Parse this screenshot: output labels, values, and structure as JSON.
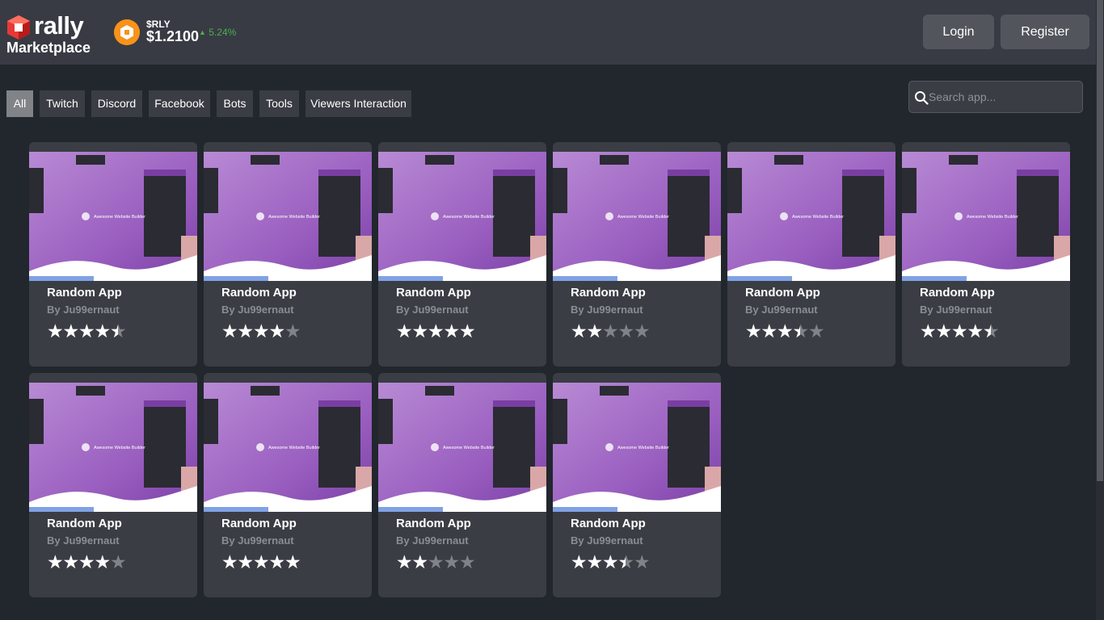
{
  "header": {
    "logo_word": "rally",
    "logo_sub": "Marketplace",
    "token": {
      "symbol": "$RLY",
      "price": "$1.2100",
      "change": "5.24%",
      "change_color": "#4caf50"
    },
    "login_label": "Login",
    "register_label": "Register"
  },
  "filters": {
    "items": [
      {
        "label": "All",
        "active": true
      },
      {
        "label": "Twitch",
        "active": false
      },
      {
        "label": "Discord",
        "active": false
      },
      {
        "label": "Facebook",
        "active": false
      },
      {
        "label": "Bots",
        "active": false
      },
      {
        "label": "Tools",
        "active": false
      },
      {
        "label": "Viewers Interaction",
        "active": false
      }
    ]
  },
  "search": {
    "placeholder": "Search app..."
  },
  "thumbnail_caption": "Awesome Website Builder",
  "apps": [
    {
      "title": "Random App",
      "author": "By Ju99ernaut",
      "rating": 4.5
    },
    {
      "title": "Random App",
      "author": "By Ju99ernaut",
      "rating": 4
    },
    {
      "title": "Random App",
      "author": "By Ju99ernaut",
      "rating": 5
    },
    {
      "title": "Random App",
      "author": "By Ju99ernaut",
      "rating": 2
    },
    {
      "title": "Random App",
      "author": "By Ju99ernaut",
      "rating": 3.5
    },
    {
      "title": "Random App",
      "author": "By Ju99ernaut",
      "rating": 4.5
    },
    {
      "title": "Random App",
      "author": "By Ju99ernaut",
      "rating": 4
    },
    {
      "title": "Random App",
      "author": "By Ju99ernaut",
      "rating": 5
    },
    {
      "title": "Random App",
      "author": "By Ju99ernaut",
      "rating": 2
    },
    {
      "title": "Random App",
      "author": "By Ju99ernaut",
      "rating": 3.5
    }
  ],
  "colors": {
    "background": "#22262d",
    "header": "#383b43",
    "card": "#3a3d44",
    "chip_active": "#808387",
    "logo_red": "#e53935",
    "thumb_purple": "#a873c9"
  }
}
